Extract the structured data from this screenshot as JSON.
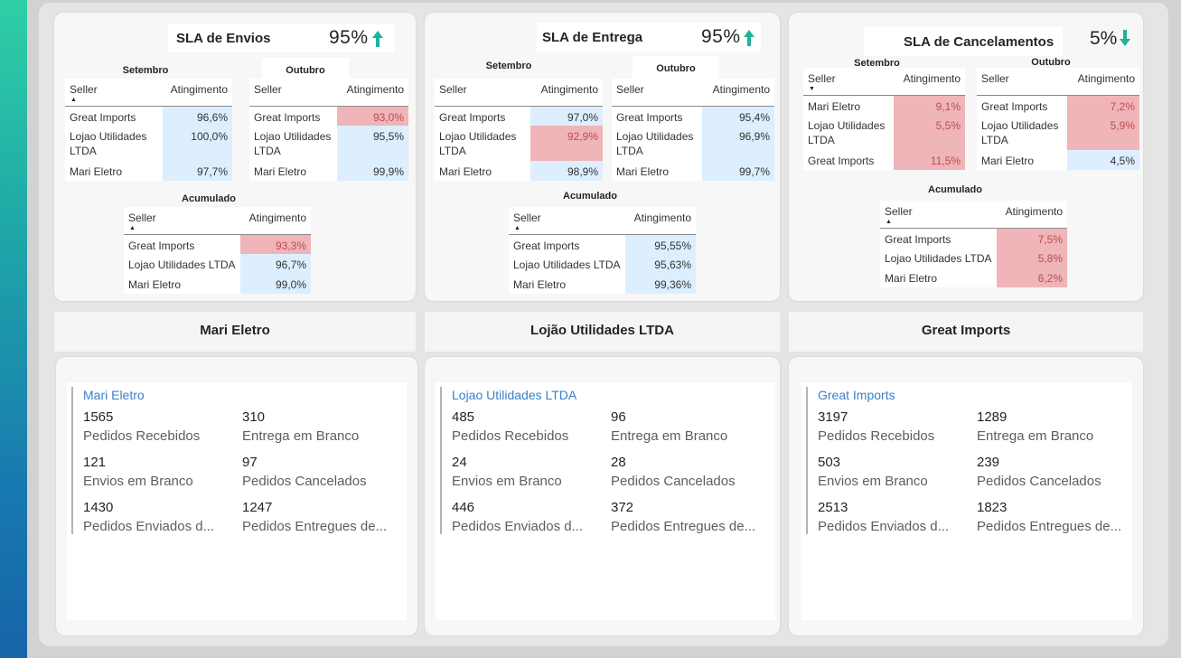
{
  "colors": {
    "up_arrow": "#1db39a",
    "down_arrow": "#1db39a",
    "good_cell": "#ddeeff",
    "bad_cell": "#efb5b8",
    "card_title": "#3a7fc9"
  },
  "sla_panels": [
    {
      "title": "SLA de Envios",
      "value": "95%",
      "trend_icon": "arrow-up-icon",
      "tables": [
        {
          "title": "Setembro",
          "col1": "Seller",
          "col2": "Atingimento",
          "rows": [
            {
              "seller": "Great Imports",
              "value": "96,6%",
              "status": "good"
            },
            {
              "seller": "Lojao Utilidades LTDA",
              "value": "100,0%",
              "status": "good"
            },
            {
              "seller": "Mari Eletro",
              "value": "97,7%",
              "status": "good"
            }
          ]
        },
        {
          "title": "Outubro",
          "col1": "Seller",
          "col2": "Atingimento",
          "rows": [
            {
              "seller": "Great Imports",
              "value": "93,0%",
              "status": "bad"
            },
            {
              "seller": "Lojao Utilidades LTDA",
              "value": "95,5%",
              "status": "good"
            },
            {
              "seller": "Mari Eletro",
              "value": "99,9%",
              "status": "good"
            }
          ]
        },
        {
          "title": "Acumulado",
          "col1": "Seller",
          "col2": "Atingimento",
          "rows": [
            {
              "seller": "Great Imports",
              "value": "93,3%",
              "status": "bad"
            },
            {
              "seller": "Lojao Utilidades LTDA",
              "value": "96,7%",
              "status": "good"
            },
            {
              "seller": "Mari Eletro",
              "value": "99,0%",
              "status": "good"
            }
          ]
        }
      ]
    },
    {
      "title": "SLA de Entrega",
      "value": "95%",
      "trend_icon": "arrow-up-icon",
      "tables": [
        {
          "title": "Setembro",
          "col1": "Seller",
          "col2": "Atingimento",
          "rows": [
            {
              "seller": "Great Imports",
              "value": "97,0%",
              "status": "good"
            },
            {
              "seller": "Lojao Utilidades LTDA",
              "value": "92,9%",
              "status": "bad"
            },
            {
              "seller": "Mari Eletro",
              "value": "98,9%",
              "status": "good"
            }
          ]
        },
        {
          "title": "Outubro",
          "col1": "Seller",
          "col2": "Atingimento",
          "rows": [
            {
              "seller": "Great Imports",
              "value": "95,4%",
              "status": "good"
            },
            {
              "seller": "Lojao Utilidades LTDA",
              "value": "96,9%",
              "status": "good"
            },
            {
              "seller": "Mari Eletro",
              "value": "99,7%",
              "status": "good"
            }
          ]
        },
        {
          "title": "Acumulado",
          "col1": "Seller",
          "col2": "Atingimento",
          "rows": [
            {
              "seller": "Great Imports",
              "value": "95,55%",
              "status": "good"
            },
            {
              "seller": "Lojao Utilidades LTDA",
              "value": "95,63%",
              "status": "good"
            },
            {
              "seller": "Mari Eletro",
              "value": "99,36%",
              "status": "good"
            }
          ]
        }
      ]
    },
    {
      "title": "SLA de Cancelamentos",
      "value": "5%",
      "trend_icon": "arrow-down-icon",
      "tables": [
        {
          "title": "Setembro",
          "col1": "Seller",
          "col2": "Atingimento",
          "rows": [
            {
              "seller": "Mari Eletro",
              "value": "9,1%",
              "status": "bad"
            },
            {
              "seller": "Lojao Utilidades LTDA",
              "value": "5,5%",
              "status": "bad"
            },
            {
              "seller": "Great Imports",
              "value": "11,5%",
              "status": "bad"
            }
          ]
        },
        {
          "title": "Outubro",
          "col1": "Seller",
          "col2": "Atingimento",
          "rows": [
            {
              "seller": "Great Imports",
              "value": "7,2%",
              "status": "bad"
            },
            {
              "seller": "Lojao Utilidades LTDA",
              "value": "5,9%",
              "status": "bad"
            },
            {
              "seller": "Mari Eletro",
              "value": "4,5%",
              "status": "good"
            }
          ]
        },
        {
          "title": "Acumulado",
          "col1": "Seller",
          "col2": "Atingimento",
          "rows": [
            {
              "seller": "Great Imports",
              "value": "7,5%",
              "status": "bad"
            },
            {
              "seller": "Lojao Utilidades LTDA",
              "value": "5,8%",
              "status": "bad"
            },
            {
              "seller": "Mari Eletro",
              "value": "6,2%",
              "status": "bad"
            }
          ]
        }
      ]
    }
  ],
  "seller_panels": [
    {
      "header": "Mari Eletro",
      "card_title": "Mari Eletro",
      "metrics": [
        {
          "value": "1565",
          "label": "Pedidos Recebidos"
        },
        {
          "value": "310",
          "label": "Entrega em Branco"
        },
        {
          "value": "121",
          "label": "Envios em Branco"
        },
        {
          "value": "97",
          "label": "Pedidos Cancelados"
        },
        {
          "value": "1430",
          "label": "Pedidos Enviados d..."
        },
        {
          "value": "1247",
          "label": "Pedidos Entregues de..."
        }
      ]
    },
    {
      "header": "Lojão Utilidades LTDA",
      "card_title": "Lojao Utilidades LTDA",
      "metrics": [
        {
          "value": "485",
          "label": "Pedidos Recebidos"
        },
        {
          "value": "96",
          "label": "Entrega em Branco"
        },
        {
          "value": "24",
          "label": "Envios em Branco"
        },
        {
          "value": "28",
          "label": "Pedidos Cancelados"
        },
        {
          "value": "446",
          "label": "Pedidos Enviados d..."
        },
        {
          "value": "372",
          "label": "Pedidos Entregues de..."
        }
      ]
    },
    {
      "header": "Great Imports",
      "card_title": "Great Imports",
      "metrics": [
        {
          "value": "3197",
          "label": "Pedidos Recebidos"
        },
        {
          "value": "1289",
          "label": "Entrega em Branco"
        },
        {
          "value": "503",
          "label": "Envios em Branco"
        },
        {
          "value": "239",
          "label": "Pedidos Cancelados"
        },
        {
          "value": "2513",
          "label": "Pedidos Enviados d..."
        },
        {
          "value": "1823",
          "label": "Pedidos Entregues de..."
        }
      ]
    }
  ]
}
